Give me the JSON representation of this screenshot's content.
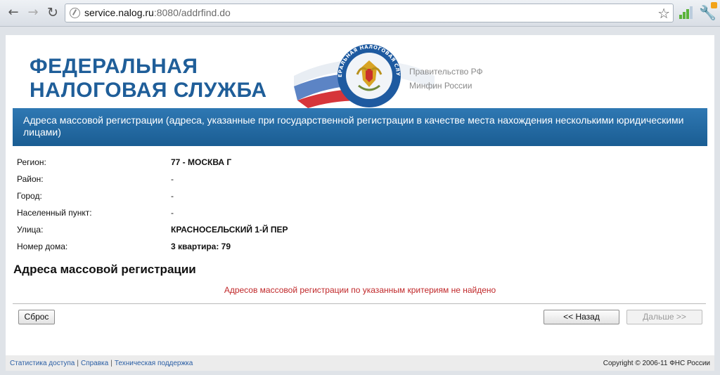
{
  "browser": {
    "url_host": "service.nalog.ru",
    "url_path": ":8080/addrfind.do"
  },
  "header": {
    "title_line1": "ФЕДЕРАЛЬНАЯ",
    "title_line2": "НАЛОГОВАЯ СЛУЖБА",
    "emblem_text": "ФЕДЕРАЛЬНАЯ НАЛОГОВАЯ СЛУЖБА",
    "gov_link1": "Правительство РФ",
    "gov_link2": "Минфин России"
  },
  "banner": {
    "text": "Адреса массовой регистрации (адреса, указанные при государственной регистрации в качестве места нахождения несколькими юридическими лицами)"
  },
  "fields": [
    {
      "label": "Регион:",
      "value": "77 - МОСКВА Г",
      "bold": true
    },
    {
      "label": "Район:",
      "value": "-",
      "bold": false
    },
    {
      "label": "Город:",
      "value": "-",
      "bold": false
    },
    {
      "label": "Населенный пункт:",
      "value": "-",
      "bold": false
    },
    {
      "label": "Улица:",
      "value": "КРАСНОСЕЛЬСКИЙ 1-Й ПЕР",
      "bold": true
    },
    {
      "label": "Номер дома:",
      "value": "3 квартира: 79",
      "bold": true
    }
  ],
  "results": {
    "title": "Адреса массовой регистрации",
    "not_found": "Адресов массовой регистрации по указанным критериям не найдено"
  },
  "buttons": {
    "reset": "Сброс",
    "back": "<< Назад",
    "next": "Дальше >>"
  },
  "footer": {
    "link1": "Статистика доступа",
    "link2": "Справка",
    "link3": "Техническая поддержка",
    "copyright": "Copyright © 2006-11 ФНС России"
  },
  "colors": {
    "brand_blue": "#1f5e99",
    "banner_blue": "#2f78b3",
    "error_red": "#c0282a"
  }
}
